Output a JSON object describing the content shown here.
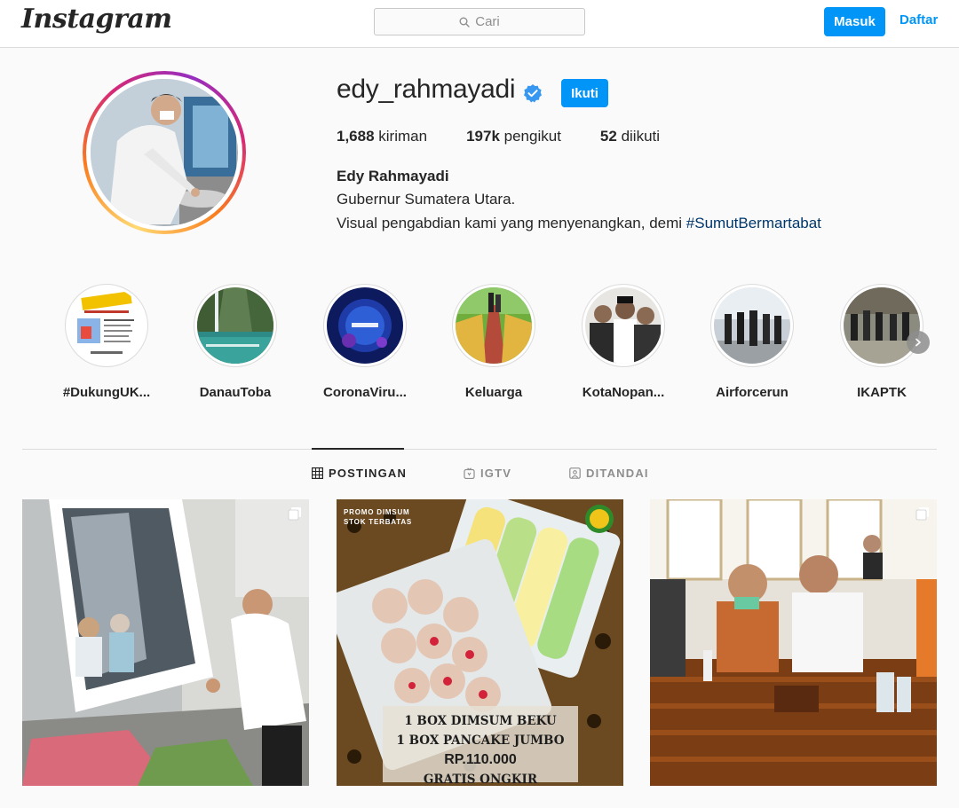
{
  "header": {
    "logo_text": "Instagram",
    "search_placeholder": "Cari",
    "login_label": "Masuk",
    "signup_label": "Daftar"
  },
  "profile": {
    "username": "edy_rahmayadi",
    "verified": true,
    "follow_label": "Ikuti",
    "posts_count": "1,688",
    "posts_label": "kiriman",
    "followers_count": "197k",
    "followers_label": "pengikut",
    "following_count": "52",
    "following_label": "diikuti",
    "full_name": "Edy Rahmayadi",
    "bio_line1": "Gubernur Sumatera Utara.",
    "bio_line2_text": "Visual pengabdian kami yang menyenangkan, demi ",
    "bio_hashtag": "#SumutBermartabat"
  },
  "highlights": [
    {
      "label": "#DukungUK..."
    },
    {
      "label": "DanauToba"
    },
    {
      "label": "CoronaViru..."
    },
    {
      "label": "Keluarga"
    },
    {
      "label": "KotaNopan..."
    },
    {
      "label": "Airforcerun"
    },
    {
      "label": "IKAPTK"
    }
  ],
  "tabs": [
    {
      "label": "POSTINGAN",
      "icon": "grid-icon",
      "active": true
    },
    {
      "label": "IGTV",
      "icon": "igtv-icon",
      "active": false
    },
    {
      "label": "DITANDAI",
      "icon": "tagged-icon",
      "active": false
    }
  ],
  "posts": [
    {
      "kind": "photo",
      "multi": true
    },
    {
      "kind": "promo",
      "multi": false,
      "tag_line1": "PROMO DIMSUM",
      "tag_line2": "STOK TERBATAS",
      "line1": "1 BOX DIMSUM BEKU",
      "line2": "1 BOX PANCAKE JUMBO",
      "price": "RP.110.000",
      "line4": "GRATIS ONGKIR"
    },
    {
      "kind": "photo",
      "multi": true
    }
  ],
  "colors": {
    "primary_blue": "#0095f6",
    "hashtag_blue": "#00376b",
    "verified_blue": "#3897f0",
    "border": "#dbdbdb",
    "background": "#fafafa"
  }
}
